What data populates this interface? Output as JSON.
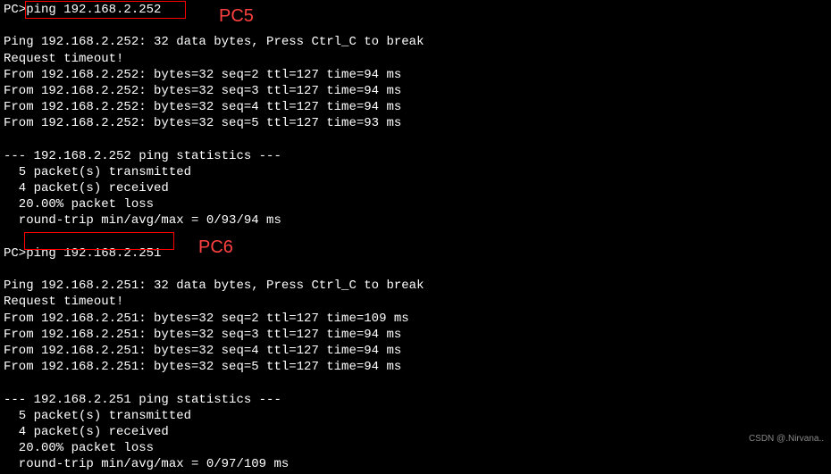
{
  "session1": {
    "prompt": "PC>",
    "command": "ping 192.168.2.252",
    "annotation": "PC5",
    "header": "Ping 192.168.2.252: 32 data bytes, Press Ctrl_C to break",
    "timeout": "Request timeout!",
    "replies": [
      "From 192.168.2.252: bytes=32 seq=2 ttl=127 time=94 ms",
      "From 192.168.2.252: bytes=32 seq=3 ttl=127 time=94 ms",
      "From 192.168.2.252: bytes=32 seq=4 ttl=127 time=94 ms",
      "From 192.168.2.252: bytes=32 seq=5 ttl=127 time=93 ms"
    ],
    "stats_header": "--- 192.168.2.252 ping statistics ---",
    "stats": [
      "  5 packet(s) transmitted",
      "  4 packet(s) received",
      "  20.00% packet loss",
      "  round-trip min/avg/max = 0/93/94 ms"
    ]
  },
  "session2": {
    "prompt": "PC>",
    "command": "ping 192.168.2.251",
    "annotation": "PC6",
    "header": "Ping 192.168.2.251: 32 data bytes, Press Ctrl_C to break",
    "timeout": "Request timeout!",
    "replies": [
      "From 192.168.2.251: bytes=32 seq=2 ttl=127 time=109 ms",
      "From 192.168.2.251: bytes=32 seq=3 ttl=127 time=94 ms",
      "From 192.168.2.251: bytes=32 seq=4 ttl=127 time=94 ms",
      "From 192.168.2.251: bytes=32 seq=5 ttl=127 time=94 ms"
    ],
    "stats_header": "--- 192.168.2.251 ping statistics ---",
    "stats": [
      "  5 packet(s) transmitted",
      "  4 packet(s) received",
      "  20.00% packet loss",
      "  round-trip min/avg/max = 0/97/109 ms"
    ]
  },
  "watermark": "CSDN @.Nirvana.."
}
